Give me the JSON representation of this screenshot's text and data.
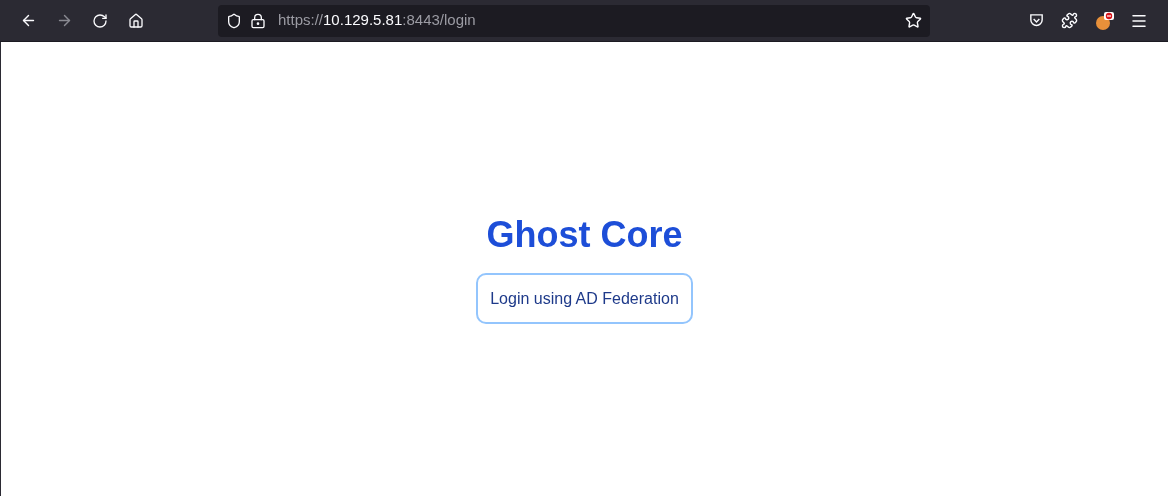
{
  "browser": {
    "back": {
      "disabled": false
    },
    "forward": {
      "disabled": true
    },
    "url": [
      {
        "text": "https://",
        "kind": "dim"
      },
      {
        "text": "10.129.5.81",
        "kind": "host"
      },
      {
        "text": ":8443/login",
        "kind": "dim"
      }
    ]
  },
  "page": {
    "title": "Ghost Core",
    "button": "Login using AD Federation"
  }
}
